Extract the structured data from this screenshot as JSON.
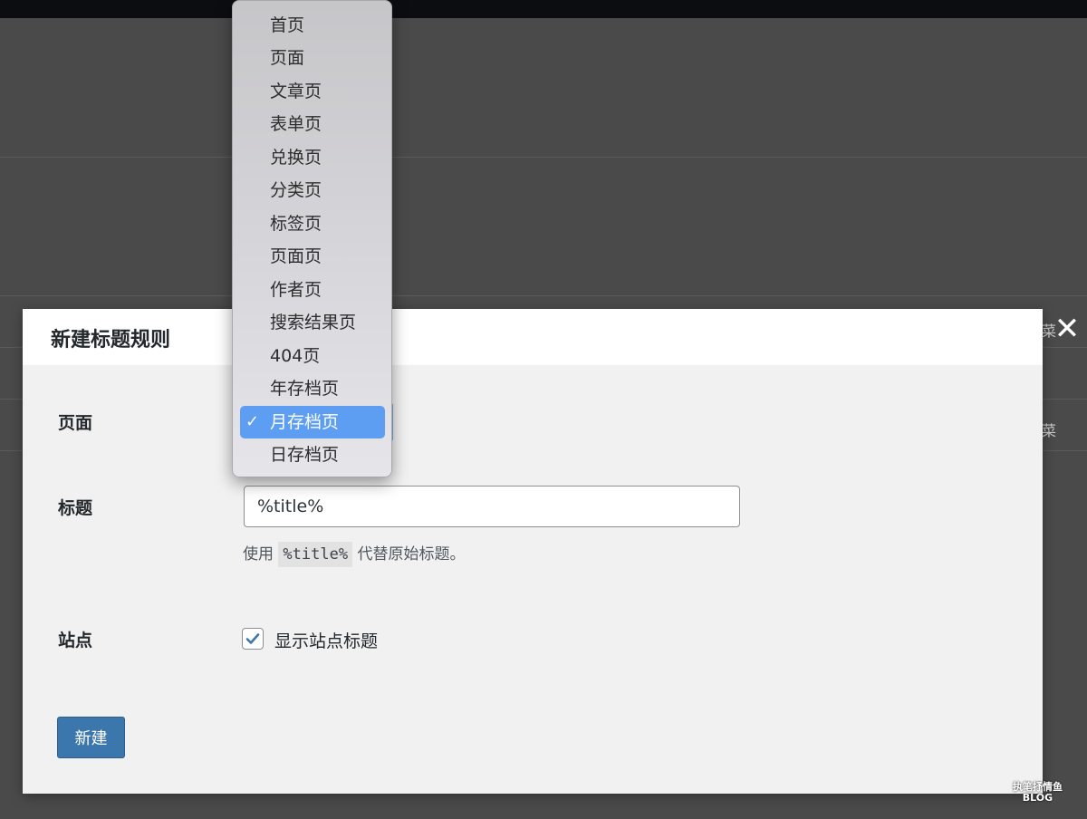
{
  "dialog": {
    "title": "新建标题规则",
    "close_symbol": "✕"
  },
  "form": {
    "page_label": "页面",
    "title_label": "标题",
    "title_value": "%title%",
    "hint_prefix": "使用",
    "hint_code": "%title%",
    "hint_suffix": "代替原始标题。",
    "site_label": "站点",
    "site_checkbox_label": "显示站点标题",
    "site_checkbox_checked": true,
    "submit_label": "新建"
  },
  "page_select": {
    "selected": "月存档页",
    "options": [
      "首页",
      "页面",
      "文章页",
      "表单页",
      "兑换页",
      "分类页",
      "标签页",
      "页面页",
      "作者页",
      "搜索结果页",
      "404页",
      "年存档页",
      "月存档页",
      "日存档页"
    ],
    "check_symbol": "✓"
  },
  "background": {
    "edge_glyph_1": "菜",
    "edge_glyph_2": "菜"
  },
  "watermark": {
    "line1": "执笔抒情鱼",
    "line2": "BLOG"
  },
  "colors": {
    "accent": "#3b77ad",
    "selected_option": "#5d9ef3",
    "overlay": "#4a4a4a"
  }
}
